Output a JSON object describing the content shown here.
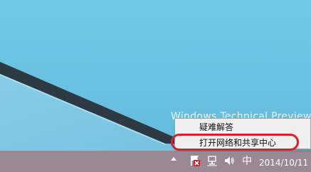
{
  "desktop": {
    "watermark": "Windows Technical Preview"
  },
  "context_menu": {
    "items": [
      {
        "label": "疑难解答"
      },
      {
        "label": "打开网络和共享中心"
      }
    ]
  },
  "taskbar": {
    "ime_label": "中",
    "date": "2014/10/11",
    "icons": [
      "show-hidden-icons",
      "action-center-flag-icon",
      "network-icon",
      "volume-icon"
    ]
  },
  "colors": {
    "highlight": "#d6202a",
    "taskbar": "#9a8894",
    "desktop": "#6ac2e2"
  }
}
